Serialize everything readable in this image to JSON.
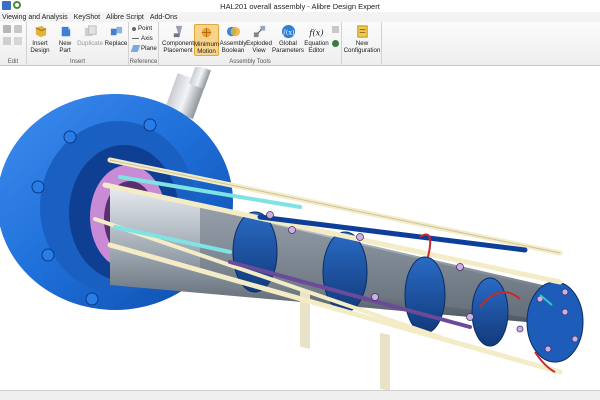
{
  "window": {
    "title": "HAL201 overall assembly - Alibre Design Expert"
  },
  "menu": {
    "items": [
      "Viewing and Analysis",
      "KeyShot",
      "Alibre Script",
      "Add-Ons"
    ]
  },
  "ribbon": {
    "groups": {
      "edit": "Edit",
      "insert": "Insert",
      "reference": "Reference",
      "assembly_tools": "Assembly Tools"
    },
    "buttons": {
      "insert_design": [
        "Insert",
        "Design"
      ],
      "new_part": [
        "New",
        "Part"
      ],
      "duplicate": "Duplicate",
      "replace": "Replace",
      "point": "Point",
      "axis": "Axis",
      "plane": "Plane",
      "component_placement": [
        "Component",
        "Placement"
      ],
      "minimum_motion": [
        "Minimum",
        "Motion"
      ],
      "assembly_boolean": [
        "Assembly",
        "Boolean"
      ],
      "exploded_view": [
        "Exploded",
        "View"
      ],
      "global_parameters": [
        "Global",
        "Parameters"
      ],
      "equation_editor": [
        "Equation",
        "Editor"
      ],
      "new_configuration": [
        "New",
        "Configuration"
      ]
    },
    "icons": {
      "equation": "f(x)",
      "global": "∫(x)"
    }
  },
  "colors": {
    "flange_blue": "#1e6fd9",
    "dark_blue": "#0d3f9a",
    "rod_cream": "#f4ecc6",
    "rod_cyan": "#7fe3e3",
    "active_button": "#f7d38c"
  }
}
